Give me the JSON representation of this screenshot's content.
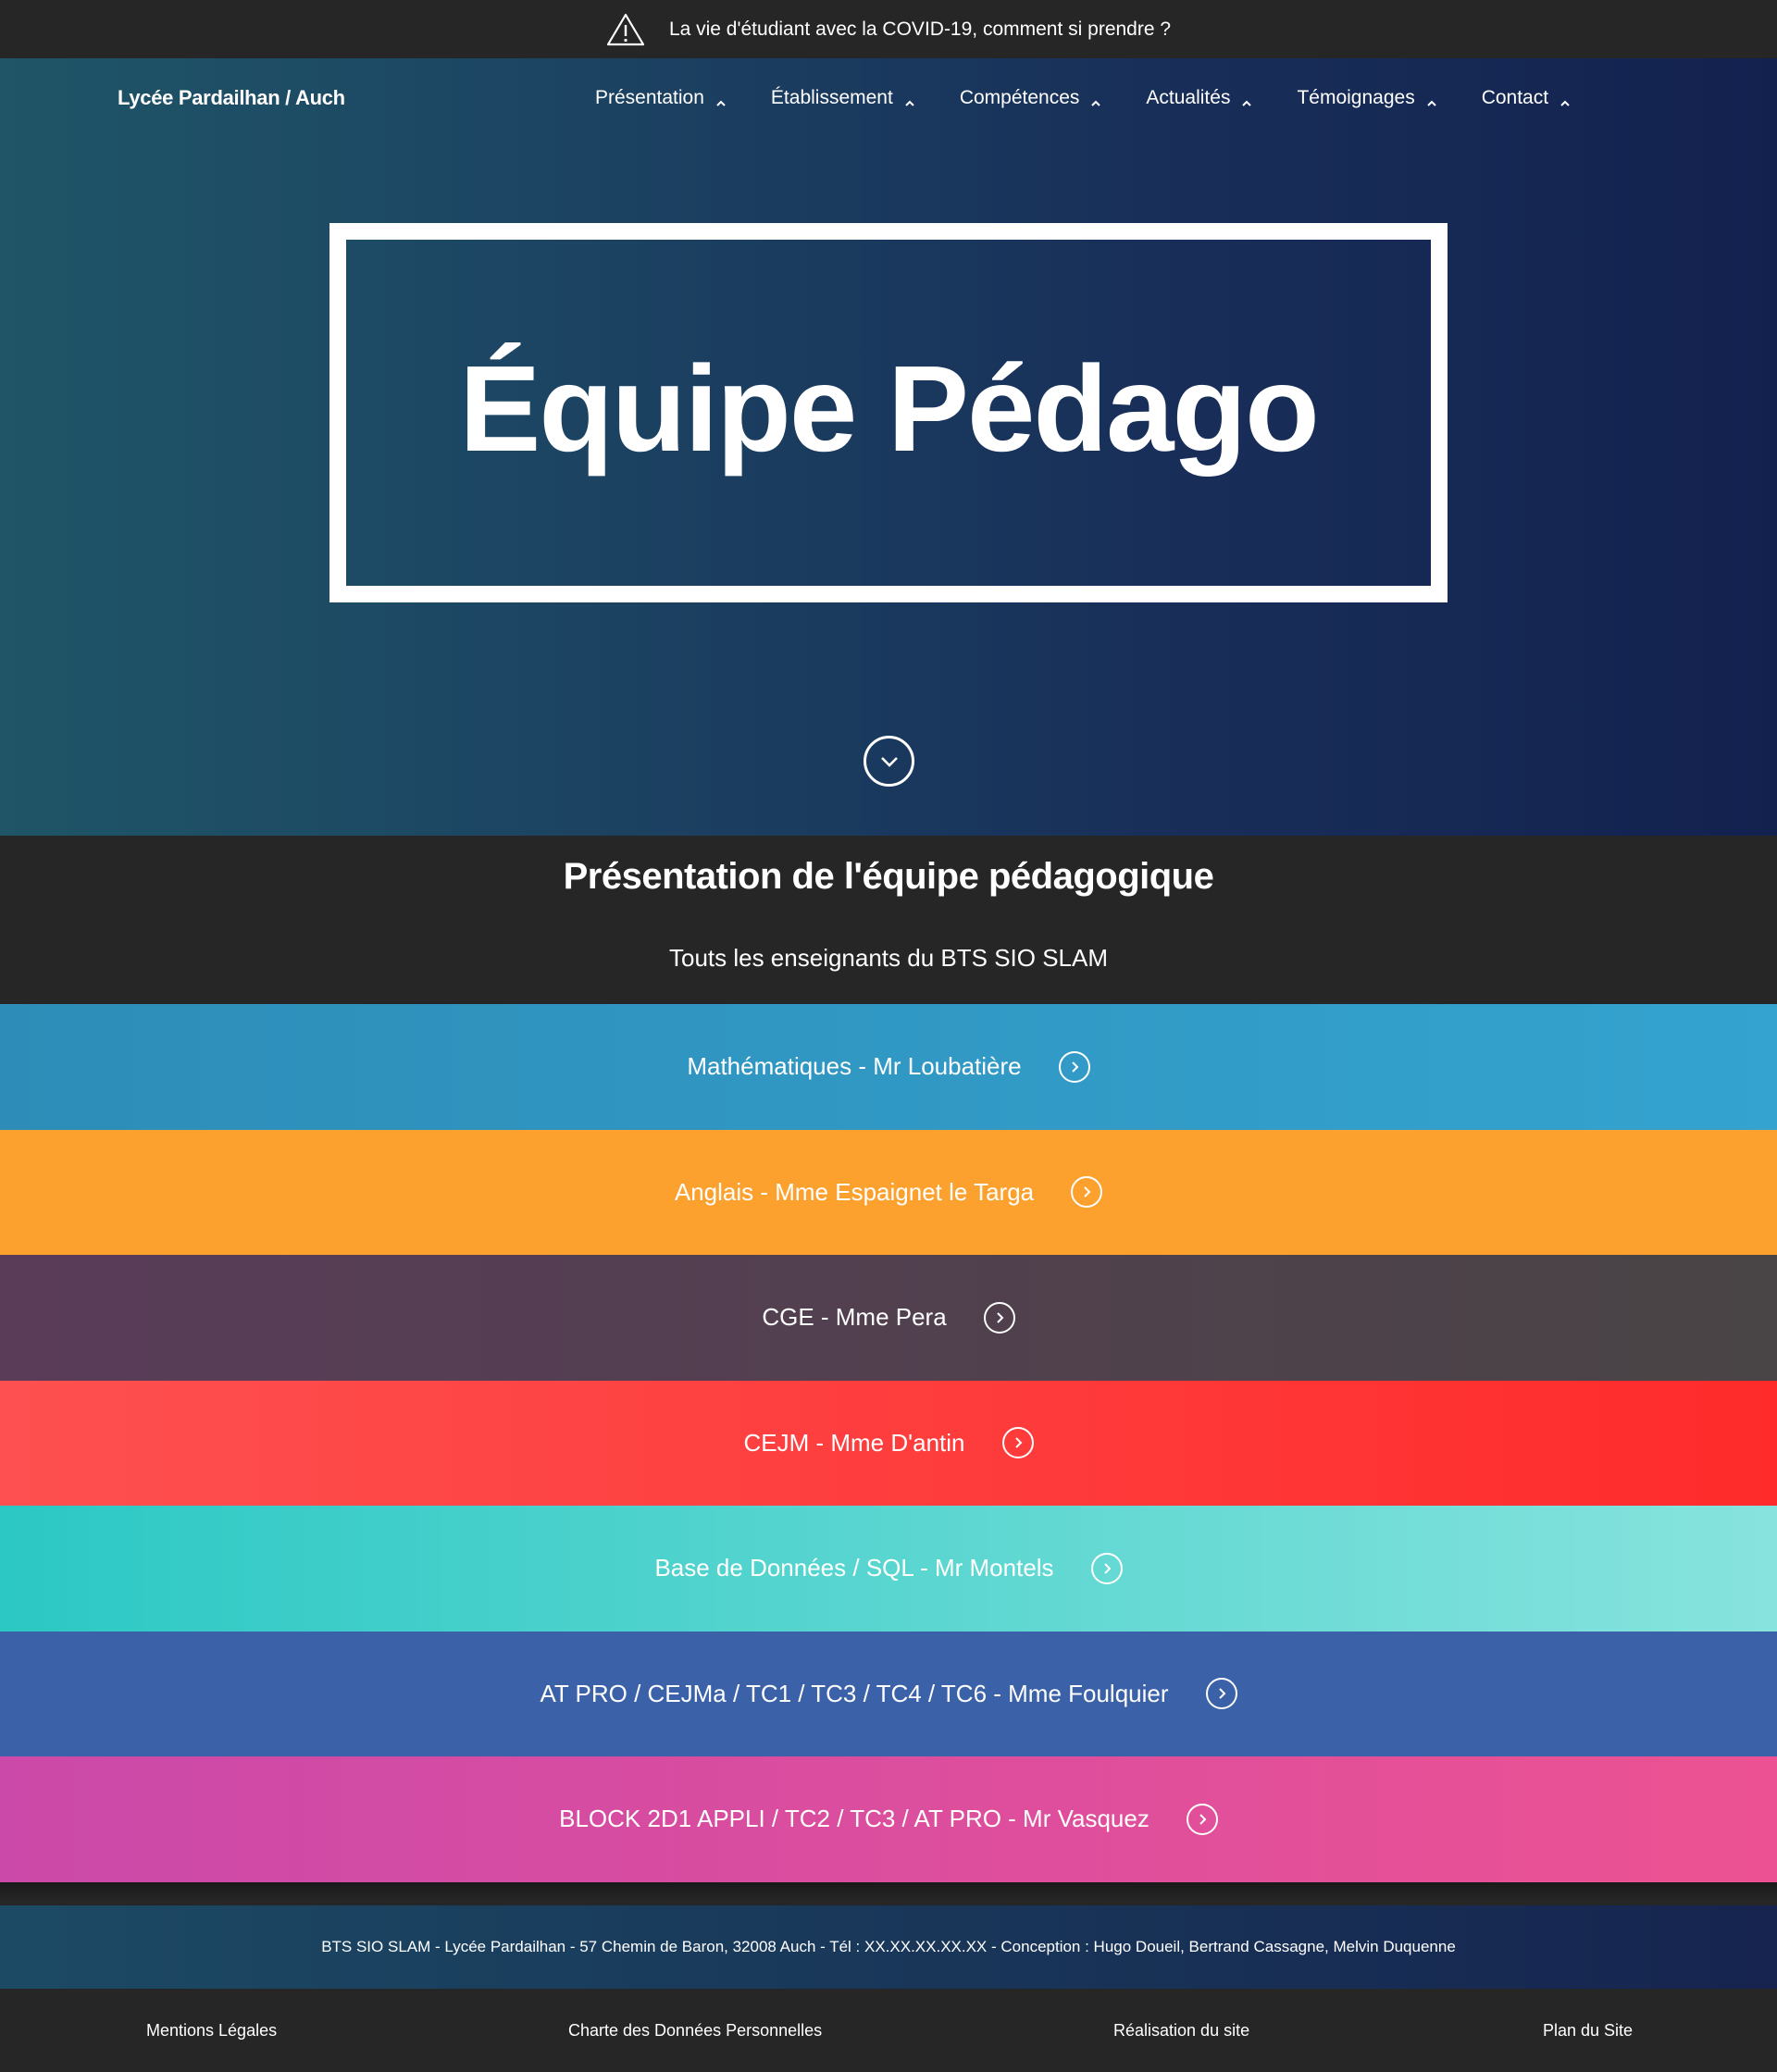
{
  "alert": {
    "icon": "warning-icon",
    "text": "La vie d'étudiant avec la COVID-19, comment si prendre ?"
  },
  "header": {
    "brand": "Lycée Pardailhan / Auch",
    "nav": [
      {
        "label": "Présentation"
      },
      {
        "label": "Établissement"
      },
      {
        "label": "Compétences"
      },
      {
        "label": "Actualités"
      },
      {
        "label": "Témoignages"
      },
      {
        "label": "Contact"
      }
    ]
  },
  "hero": {
    "title": "Équipe Pédago",
    "scroll_icon": "chevron-down-circle-icon"
  },
  "intro": {
    "heading": "Présentation de l'équipe pédagogique",
    "subheading": "Touts les enseignants du BTS SIO SLAM"
  },
  "teachers": [
    {
      "label": "Mathématiques - Mr Loubatière",
      "color": "#31A0CB"
    },
    {
      "label": "Anglais - Mme Espaignet le Targa",
      "color": "#FDA12E"
    },
    {
      "label": "CGE - Mme Pera",
      "color": "#52404F"
    },
    {
      "label": "CEJM - Mme D'antin",
      "color": "#FF3E3E"
    },
    {
      "label": "Base de Données / SQL - Mr Montels",
      "color": "#4DD3CD"
    },
    {
      "label": "AT PRO / CEJMa / TC1 / TC3 / TC4 / TC6 - Mme Foulquier",
      "color": "#3B61A8"
    },
    {
      "label": "BLOCK 2D1 APPLI / TC2 / TC3 / AT PRO - Mr Vasquez",
      "color": "#DD4E9E"
    }
  ],
  "footer": {
    "info": "BTS SIO SLAM - Lycée Pardailhan - 57 Chemin de Baron, 32008 Auch - Tél : XX.XX.XX.XX.XX - Conception : Hugo Doueil, Bertrand Cassagne, Melvin Duquenne",
    "links": [
      "Mentions Légales",
      "Charte des Données Personnelles",
      "Réalisation du site",
      "Plan du Site"
    ]
  }
}
